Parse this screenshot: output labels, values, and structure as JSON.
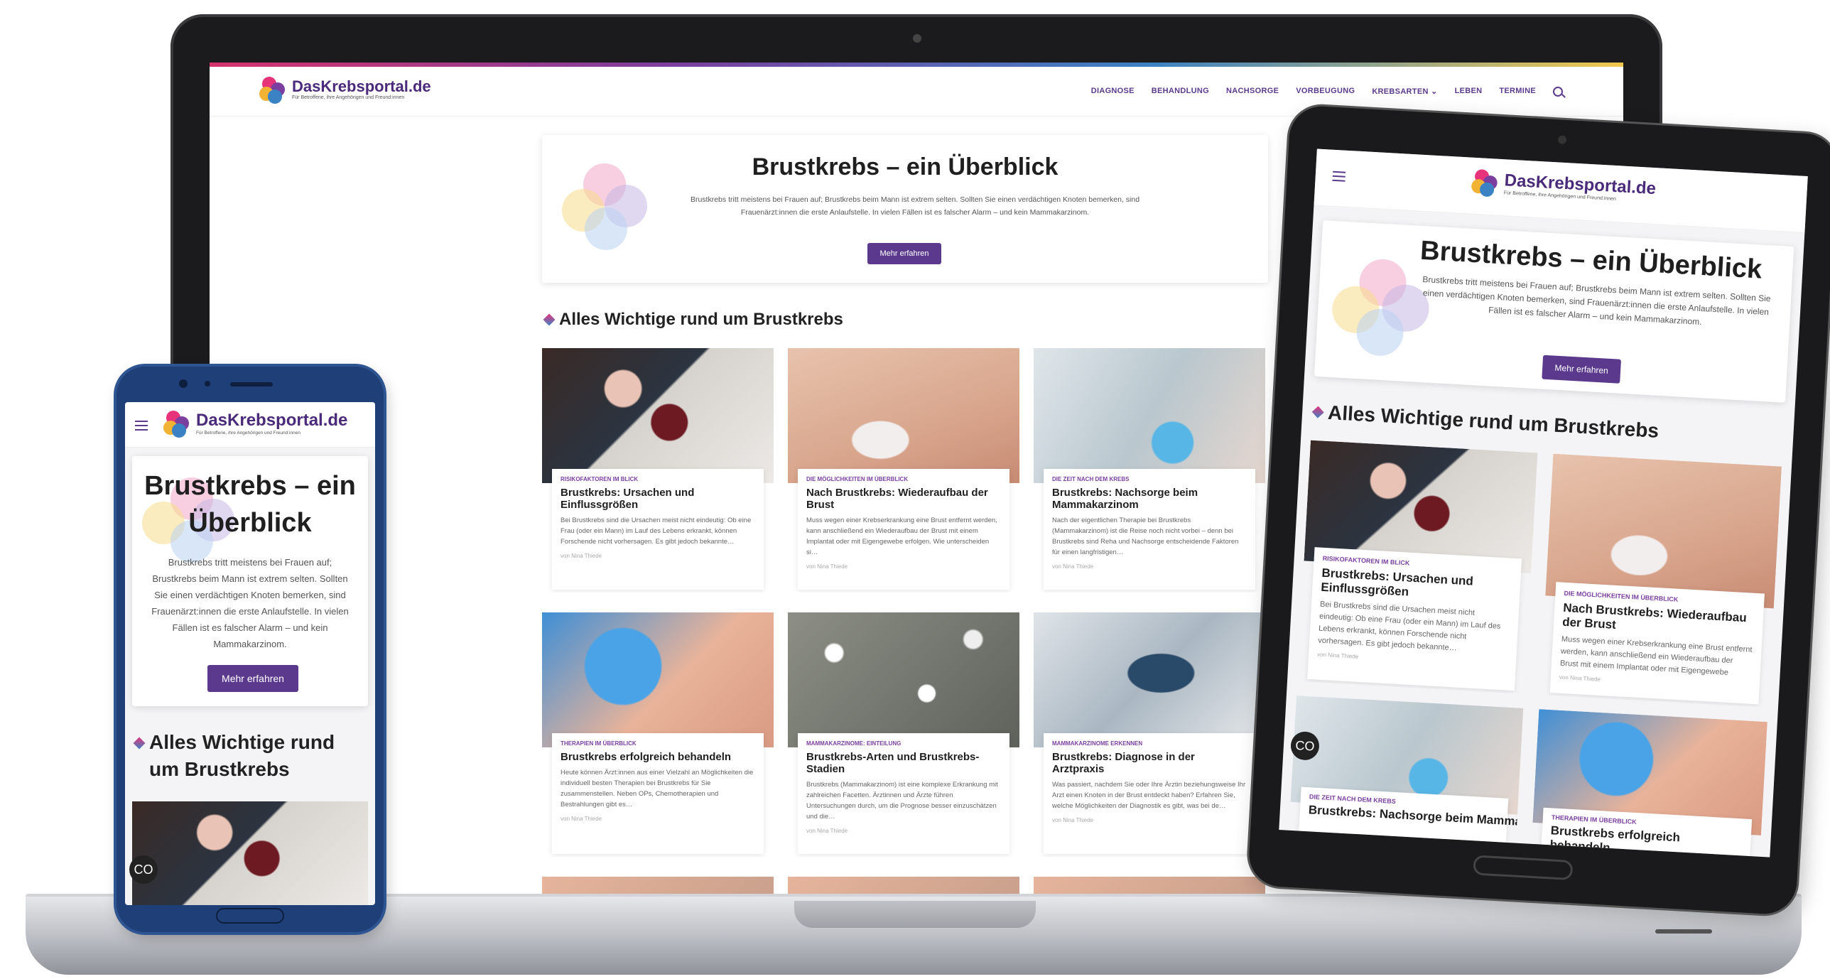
{
  "site": {
    "logo_name": "DasKrebsportal.de",
    "logo_tagline": "Für Betroffene, ihre Angehörigen und Freund:innen",
    "nav": [
      "DIAGNOSE",
      "BEHANDLUNG",
      "NACHSORGE",
      "VORBEUGUNG",
      "KREBSARTEN",
      "LEBEN",
      "TERMINE"
    ],
    "colors": {
      "brand_purple": "#5b3a8e",
      "pink": "#e6337a",
      "blue": "#3b82c4",
      "yellow": "#f2b233"
    }
  },
  "hero": {
    "title": "Brustkrebs – ein Überblick",
    "text": "Brustkrebs tritt meistens bei Frauen auf; Brustkrebs beim Mann ist extrem selten. Sollten Sie einen verdächtigen Knoten bemerken, sind Frauenärzt:innen die erste Anlaufstelle. In vielen Fällen ist es falscher Alarm – und kein Mammakarzinom.",
    "button": "Mehr erfahren"
  },
  "section_title": "Alles Wichtige rund um Brustkrebs",
  "cards": [
    {
      "kicker": "RISIKOFAKTOREN IM BLICK",
      "title": "Brustkrebs: Ursachen und Einflussgrößen",
      "text": "Bei Brustkrebs sind die Ursachen meist nicht eindeutig: Ob eine Frau (oder ein Mann) im Lauf des Lebens erkrankt, können Forschende nicht vorhersagen. Es gibt jedoch bekannte…",
      "author": "von Nina Thiede",
      "image": "wine"
    },
    {
      "kicker": "DIE MÖGLICHKEITEN IM ÜBERBLICK",
      "title": "Nach Brustkrebs: Wiederaufbau der Brust",
      "text": "Muss wegen einer Krebserkrankung eine Brust entfernt werden, kann anschließend ein Wiederaufbau der Brust mit einem Implantat oder mit Eigengewebe erfolgen. Wie unterscheiden si…",
      "author": "von Nina Thiede",
      "image": "implant"
    },
    {
      "kicker": "DIE ZEIT NACH DEM KREBS",
      "title": "Brustkrebs: Nachsorge beim Mammakarzinom",
      "text": "Nach der eigentlichen Therapie bei Brustkrebs (Mammakarzinom) ist die Reise noch nicht vorbei – denn bei Brustkrebs sind Reha und Nachsorge entscheidende Faktoren für einen langfristigen…",
      "author": "von Nina Thiede",
      "image": "ultra"
    },
    {
      "kicker": "THERAPIEN IM ÜBERBLICK",
      "title": "Brustkrebs erfolgreich behandeln",
      "text": "Heute können Ärzt:innen aus einer Vielzahl an Möglichkeiten die individuell besten Therapien bei Brustkrebs für Sie zusammenstellen. Neben OPs, Chemotherapien und Bestrahlungen gibt es…",
      "author": "von Nina Thiede",
      "image": "glove"
    },
    {
      "kicker": "MAMMAKARZINOME: EINTEILUNG",
      "title": "Brustkrebs-Arten und Brustkrebs-Stadien",
      "text": "Brustkrebs (Mammakarzinom) ist eine komplexe Erkrankung mit zahlreichen Facetten. Ärztinnen und Ärzte führen Untersuchungen durch, um die Prognose besser einzuschätzen und die…",
      "author": "von Nina Thiede",
      "image": "cells"
    },
    {
      "kicker": "MAMMAKARZINOME ERKENNEN",
      "title": "Brustkrebs: Diagnose in der Arztpraxis",
      "text": "Was passiert, nachdem Sie oder Ihre Ärztin beziehungsweise Ihr Arzt einen Knoten in der Brust entdeckt haben? Erfahren Sie, welche Möglichkeiten der Diagnostik es gibt, was bei de…",
      "author": "von Nina Thiede",
      "image": "mammo"
    }
  ],
  "tablet": {
    "hero_title": "Brustkrebs – ein Überblick",
    "hero_text": "Brustkrebs tritt meistens bei Frauen auf; Brustkrebs beim Mann ist extrem selten. Sollten Sie einen verdächtigen Knoten bemerken, sind Frauenärzt:innen die erste Anlaufstelle. In vielen Fällen ist es falscher Alarm – und kein Mammakarzinom.",
    "button": "Mehr erfahren",
    "section_title": "Alles Wichtige rund um Brustkrebs",
    "cookie": "CO"
  },
  "phone": {
    "hero_title": "Brustkrebs – ein Überblick",
    "hero_text": "Brustkrebs tritt meistens bei Frauen auf; Brustkrebs beim Mann ist extrem selten. Sollten Sie einen verdächtigen Knoten bemerken, sind Frauenärzt:innen die erste Anlaufstelle. In vielen Fällen ist es falscher Alarm – und kein Mammakarzinom.",
    "button": "Mehr erfahren",
    "section_title": "Alles Wichtige rund um Brustkrebs",
    "cookie": "CO"
  }
}
